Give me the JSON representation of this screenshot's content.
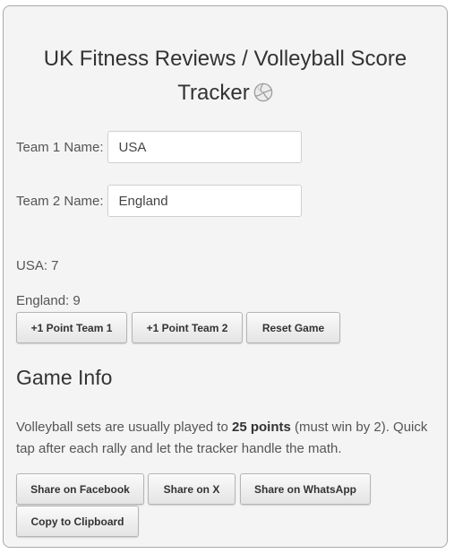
{
  "title": {
    "line1": "UK Fitness Reviews / Volleyball Score",
    "line2": "Tracker"
  },
  "form": {
    "team1_label": "Team 1 Name:",
    "team1_value": "USA",
    "team2_label": "Team 2 Name:",
    "team2_value": "England"
  },
  "scores": {
    "team1": "USA: 7",
    "team2": "England: 9"
  },
  "controls": {
    "point_team1": "+1 Point Team 1",
    "point_team2": "+1 Point Team 2",
    "reset": "Reset Game"
  },
  "info": {
    "heading": "Game Info",
    "text_before": "Volleyball sets are usually played to ",
    "text_bold": "25 points",
    "text_after": " (must win by 2). Quick tap after each rally and let the tracker handle the math."
  },
  "share": {
    "facebook": "Share on Facebook",
    "x": "Share on X",
    "whatsapp": "Share on WhatsApp",
    "clipboard": "Copy to Clipboard"
  },
  "icons": {
    "title_icon": "volleyball-icon"
  }
}
